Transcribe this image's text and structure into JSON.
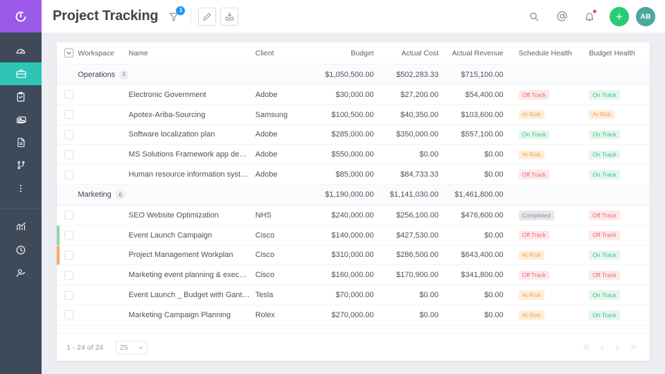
{
  "brand": {
    "logo_name": "circular-c-logo",
    "purple": "#9b59e8",
    "sidebar_bg": "#3e4a59",
    "active_teal": "#2ec4b6"
  },
  "sidebar": {
    "items": [
      {
        "icon": "gauge-icon",
        "active": false
      },
      {
        "icon": "briefcase-icon",
        "active": true
      },
      {
        "icon": "clipboard-check-icon",
        "active": false
      },
      {
        "icon": "media-image-icon",
        "active": false
      },
      {
        "icon": "document-icon",
        "active": false
      },
      {
        "icon": "workflow-branch-icon",
        "active": false
      },
      {
        "icon": "more-vertical-icon",
        "active": false
      }
    ],
    "bottom_items": [
      {
        "icon": "analytics-chart-icon",
        "active": false
      },
      {
        "icon": "clock-icon",
        "active": false
      },
      {
        "icon": "user-check-icon",
        "active": false
      }
    ]
  },
  "header": {
    "title": "Project Tracking",
    "filter_icon": "filter-icon",
    "filter_count": "1",
    "edit_icon": "pencil-icon",
    "export_icon": "export-tray-icon",
    "search_icon": "search-icon",
    "mention_icon": "at-mention-icon",
    "notification_icon": "bell-icon",
    "add_icon": "plus-icon",
    "avatar_initials": "AB"
  },
  "table": {
    "columns": [
      {
        "key": "check",
        "label": ""
      },
      {
        "key": "ws",
        "label": "Workspace"
      },
      {
        "key": "name",
        "label": "Name"
      },
      {
        "key": "client",
        "label": "Client"
      },
      {
        "key": "budget",
        "label": "Budget"
      },
      {
        "key": "cost",
        "label": "Actual Cost"
      },
      {
        "key": "rev",
        "label": "Actual Revenue"
      },
      {
        "key": "sh",
        "label": "Schedule Health"
      },
      {
        "key": "bh",
        "label": "Budget Health"
      }
    ],
    "groups": [
      {
        "name": "Operations",
        "count": "5",
        "budget": "$1,050,500.00",
        "cost": "$502,283.33",
        "revenue": "$715,100.00",
        "rows": [
          {
            "name": "Electronic Government",
            "client": "Adobe",
            "budget": "$30,000.00",
            "cost": "$27,200.00",
            "revenue": "$54,400.00",
            "schedule_health": "Off Track",
            "schedule_class": "b-off",
            "budget_health": "On Track",
            "budget_class": "b-on",
            "accent": ""
          },
          {
            "name": "Apotex-Ariba-Sourcing",
            "client": "Samsung",
            "budget": "$100,500.00",
            "cost": "$40,350.00",
            "revenue": "$103,600.00",
            "schedule_health": "At Risk",
            "schedule_class": "b-risk",
            "budget_health": "At Risk",
            "budget_class": "b-risk",
            "accent": ""
          },
          {
            "name": "Software localization plan",
            "client": "Adobe",
            "budget": "$285,000.00",
            "cost": "$350,000.00",
            "revenue": "$557,100.00",
            "schedule_health": "On Track",
            "schedule_class": "b-on",
            "budget_health": "On Track",
            "budget_class": "b-on",
            "accent": ""
          },
          {
            "name": "MS Solutions Framework app devel...",
            "client": "Adobe",
            "budget": "$550,000.00",
            "cost": "$0.00",
            "revenue": "$0.00",
            "schedule_health": "At Risk",
            "schedule_class": "b-risk",
            "budget_health": "On Track",
            "budget_class": "b-on",
            "accent": ""
          },
          {
            "name": "Human resource information syste...",
            "client": "Adobe",
            "budget": "$85,000.00",
            "cost": "$84,733.33",
            "revenue": "$0.00",
            "schedule_health": "Off Track",
            "schedule_class": "b-off",
            "budget_health": "On Track",
            "budget_class": "b-on",
            "accent": ""
          }
        ]
      },
      {
        "name": "Marketing",
        "count": "6",
        "budget": "$1,190,000.00",
        "cost": "$1,141,030.00",
        "revenue": "$1,461,800.00",
        "rows": [
          {
            "name": "SEO Website Optimization",
            "client": "NHS",
            "budget": "$240,000.00",
            "cost": "$256,100.00",
            "revenue": "$476,600.00",
            "schedule_health": "Completed",
            "schedule_class": "b-done",
            "budget_health": "Off Track",
            "budget_class": "b-off",
            "accent": ""
          },
          {
            "name": "Event Launch Campaign",
            "client": "Cisco",
            "budget": "$140,000.00",
            "cost": "$427,530.00",
            "revenue": "$0.00",
            "schedule_health": "Off Track",
            "schedule_class": "b-off",
            "budget_health": "Off Track",
            "budget_class": "b-off",
            "accent": "#8fd9a8"
          },
          {
            "name": "Project Management Workplan",
            "client": "Cisco",
            "budget": "$310,000.00",
            "cost": "$286,500.00",
            "revenue": "$643,400.00",
            "schedule_health": "At Risk",
            "schedule_class": "b-risk",
            "budget_health": "On Track",
            "budget_class": "b-on",
            "accent": "#f5a96a"
          },
          {
            "name": "Marketing event planning & executi...",
            "client": "Cisco",
            "budget": "$160,000.00",
            "cost": "$170,900.00",
            "revenue": "$341,800.00",
            "schedule_health": "Off Track",
            "schedule_class": "b-off",
            "budget_health": "Off Track",
            "budget_class": "b-off",
            "accent": ""
          },
          {
            "name": "Event Launch _ Budget with Gantt ...",
            "client": "Tesla",
            "budget": "$70,000.00",
            "cost": "$0.00",
            "revenue": "$0.00",
            "schedule_health": "At Risk",
            "schedule_class": "b-risk",
            "budget_health": "On Track",
            "budget_class": "b-on",
            "accent": ""
          },
          {
            "name": "Marketing Campaign Planning",
            "client": "Rolex",
            "budget": "$270,000.00",
            "cost": "$0.00",
            "revenue": "$0.00",
            "schedule_health": "At Risk",
            "schedule_class": "b-risk",
            "budget_health": "On Track",
            "budget_class": "b-on",
            "accent": ""
          }
        ]
      }
    ]
  },
  "footer": {
    "range_text": "1 - 24 of 24",
    "page_size": "25",
    "first_icon": "first-page-icon",
    "prev_icon": "prev-page-icon",
    "next_icon": "next-page-icon",
    "last_icon": "last-page-icon"
  }
}
